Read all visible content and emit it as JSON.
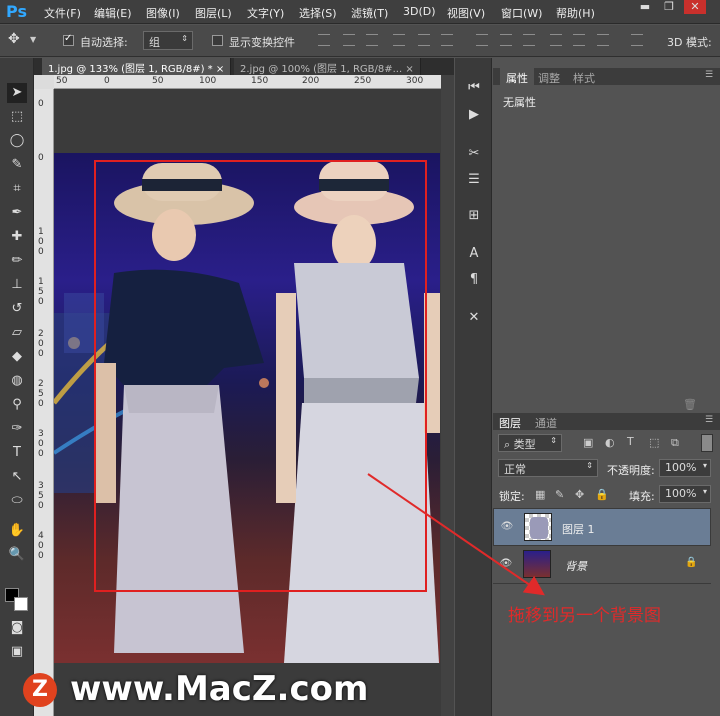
{
  "app": {
    "logo": "Ps"
  },
  "menu": [
    "文件(F)",
    "编辑(E)",
    "图像(I)",
    "图层(L)",
    "文字(Y)",
    "选择(S)",
    "滤镜(T)",
    "3D(D)",
    "视图(V)",
    "窗口(W)",
    "帮助(H)"
  ],
  "window_controls": {
    "minimize": "▬",
    "restore": "❐",
    "close": "✕"
  },
  "options": {
    "auto_select_label": "自动选择:",
    "auto_select_value": "组",
    "show_transform_label": "显示变换控件",
    "mode_3d_label": "3D 模式:"
  },
  "tabs": [
    {
      "label": "1.jpg @ 133% (图层 1, RGB/8#) *",
      "close": "×"
    },
    {
      "label": "2.jpg @ 100% (图层 1, RGB/8#...",
      "close": "×"
    }
  ],
  "ruler_h": [
    "50",
    "0",
    "50",
    "100",
    "150",
    "200",
    "250",
    "300"
  ],
  "ruler_v": [
    "0",
    "5",
    "0",
    "1 0 0",
    "1 5 0",
    "2 0 0",
    "2 5 0",
    "3 0 0",
    "3 5 0",
    "4 0 0"
  ],
  "properties_panel": {
    "tabs": [
      "属性",
      "调整",
      "样式"
    ],
    "content": "无属性"
  },
  "layers_panel": {
    "tabs": [
      "图层",
      "通道"
    ],
    "filter_label": "类型",
    "blend_mode": "正常",
    "opacity_label": "不透明度:",
    "opacity_value": "100%",
    "lock_label": "锁定:",
    "fill_label": "填充:",
    "fill_value": "100%",
    "layers": [
      {
        "name": "图层 1",
        "selected": true
      },
      {
        "name": "背景",
        "locked": true
      }
    ]
  },
  "annotation": "拖移到另一个背景图",
  "watermark": {
    "logo": "Z",
    "text": "www.MacZ.com"
  },
  "colors": {
    "selection": "#e02020",
    "annotation": "#e02a2a",
    "accent": "#31a8ff",
    "watermark_logo": "#e0421e"
  }
}
